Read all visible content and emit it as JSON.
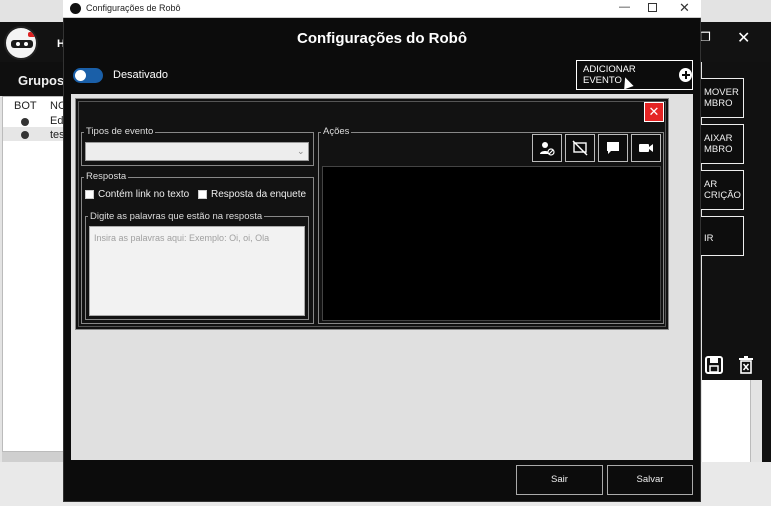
{
  "background_app": {
    "header_letter": "H",
    "groups_label": "Grupos:",
    "columns": [
      "BOT",
      "NO"
    ],
    "rows": [
      {
        "name": "Edi"
      },
      {
        "name": "test"
      }
    ],
    "side_buttons": [
      "MOVER\nMBRO",
      "AIXAR\nMBRO",
      "AR\nCRIÇÃO",
      "IR"
    ],
    "window_restore": "❐",
    "window_close": "✕"
  },
  "dialog": {
    "window_title": "Configurações de Robô",
    "controls": {
      "minimize": "—",
      "close": "✕"
    },
    "heading": "Configurações do Robô",
    "toggle_label": "Desativado",
    "toggle_on": false,
    "add_event_label": "ADICIONAR EVENTO",
    "editor": {
      "close_glyph": "✕",
      "tipos_evento_legend": "Tipos de evento",
      "tipos_evento_value": "",
      "resposta_legend": "Resposta",
      "check_link_label": "Contém link no texto",
      "check_enquete_label": "Resposta da enquete",
      "palavras_legend": "Digite as palavras que estão na resposta",
      "palavras_placeholder": "Insira as palavras aqui: Exemplo: Oi, oi, Ola",
      "acoes_legend": "Ações",
      "action_icons": [
        "user-block-icon",
        "screen-off-icon",
        "chat-icon",
        "video-camera-icon"
      ]
    },
    "sair_label": "Sair",
    "salvar_label": "Salvar"
  },
  "colors": {
    "toggle": "#1a5fa8",
    "close_red": "#e52424",
    "dark": "#0c0c0c"
  }
}
